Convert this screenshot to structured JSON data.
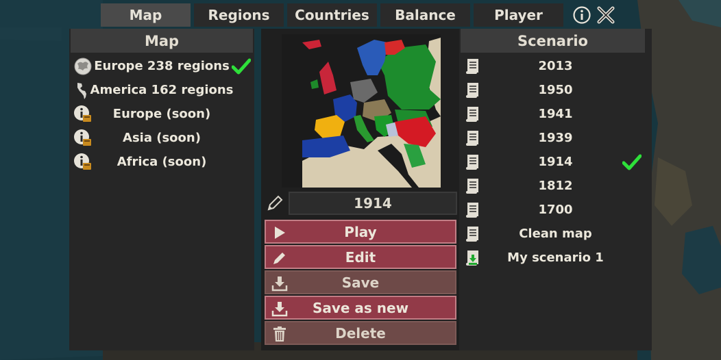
{
  "tabs": [
    {
      "label": "Map",
      "active": true
    },
    {
      "label": "Regions",
      "active": false
    },
    {
      "label": "Countries",
      "active": false
    },
    {
      "label": "Balance",
      "active": false
    },
    {
      "label": "Player",
      "active": false
    }
  ],
  "top_icons": [
    "info-icon",
    "close-icon"
  ],
  "map_panel": {
    "header": "Map",
    "items": [
      {
        "label": "Europe 238 regions",
        "icon": "europe-globe-icon",
        "selected": true
      },
      {
        "label": "America 162 regions",
        "icon": "america-silhouette-icon",
        "selected": false
      },
      {
        "label": "Europe (soon)",
        "icon": "info-locked-icon",
        "selected": false
      },
      {
        "label": "Asia (soon)",
        "icon": "info-locked-icon",
        "selected": false
      },
      {
        "label": "Africa (soon)",
        "icon": "info-locked-icon",
        "selected": false
      }
    ]
  },
  "center_panel": {
    "scenario_name": "1914",
    "actions": [
      {
        "label": "Play",
        "icon": "play-icon",
        "style": "strong"
      },
      {
        "label": "Edit",
        "icon": "pencil-icon",
        "style": "strong"
      },
      {
        "label": "Save",
        "icon": "download-icon",
        "style": "muted"
      },
      {
        "label": "Save as new",
        "icon": "download-icon",
        "style": "strong"
      },
      {
        "label": "Delete",
        "icon": "trash-icon",
        "style": "muted"
      }
    ]
  },
  "scenario_panel": {
    "header": "Scenario",
    "items": [
      {
        "label": "2013",
        "icon": "scroll-icon",
        "selected": false
      },
      {
        "label": "1950",
        "icon": "scroll-icon",
        "selected": false
      },
      {
        "label": "1941",
        "icon": "scroll-icon",
        "selected": false
      },
      {
        "label": "1939",
        "icon": "scroll-icon",
        "selected": false
      },
      {
        "label": "1914",
        "icon": "scroll-icon",
        "selected": true
      },
      {
        "label": "1812",
        "icon": "scroll-icon",
        "selected": false
      },
      {
        "label": "1700",
        "icon": "scroll-icon",
        "selected": false
      },
      {
        "label": "Clean map",
        "icon": "scroll-icon",
        "selected": false
      },
      {
        "label": "My scenario 1",
        "icon": "scroll-download-icon",
        "selected": false
      }
    ]
  },
  "colors": {
    "accent_check": "#2ee03a",
    "action_strong": "#923a48",
    "action_muted": "#6e4a48",
    "panel_bg": "#262626",
    "header_bg": "#3c3c3c"
  }
}
